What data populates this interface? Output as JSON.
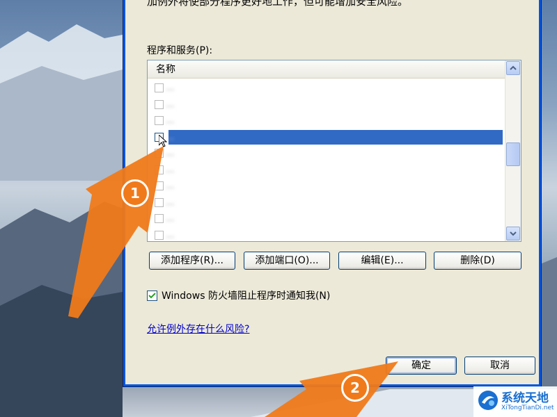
{
  "dialog": {
    "intro_text": "加例外将使部分程序更好地工作，但可能增加安全风险。",
    "list_label": "程序和服务(P):",
    "list_header": "名称",
    "list_items": [
      {
        "name": "...",
        "checked": false,
        "selected": false
      },
      {
        "name": "...",
        "checked": false,
        "selected": false
      },
      {
        "name": "...",
        "checked": false,
        "selected": false
      },
      {
        "name": "...",
        "checked": false,
        "selected": true
      },
      {
        "name": "...",
        "checked": false,
        "selected": false
      },
      {
        "name": "...",
        "checked": false,
        "selected": false
      },
      {
        "name": "...",
        "checked": false,
        "selected": false
      },
      {
        "name": "...",
        "checked": false,
        "selected": false
      },
      {
        "name": "...",
        "checked": false,
        "selected": false
      },
      {
        "name": "...",
        "checked": false,
        "selected": false
      }
    ],
    "buttons": {
      "add_program": "添加程序(R)...",
      "add_port": "添加端口(O)...",
      "edit": "编辑(E)...",
      "delete": "删除(D)"
    },
    "notify_checkbox": {
      "label": "Windows 防火墙阻止程序时通知我(N)",
      "checked": true
    },
    "risk_link": "允许例外存在什么风险?",
    "ok_button": "确定",
    "cancel_button": "取消"
  },
  "annotations": {
    "step1": "1",
    "step2": "2",
    "arrow_color": "#f07a1a"
  },
  "watermark": {
    "title": "系统天地",
    "url": "XiTongTianDi.net"
  }
}
